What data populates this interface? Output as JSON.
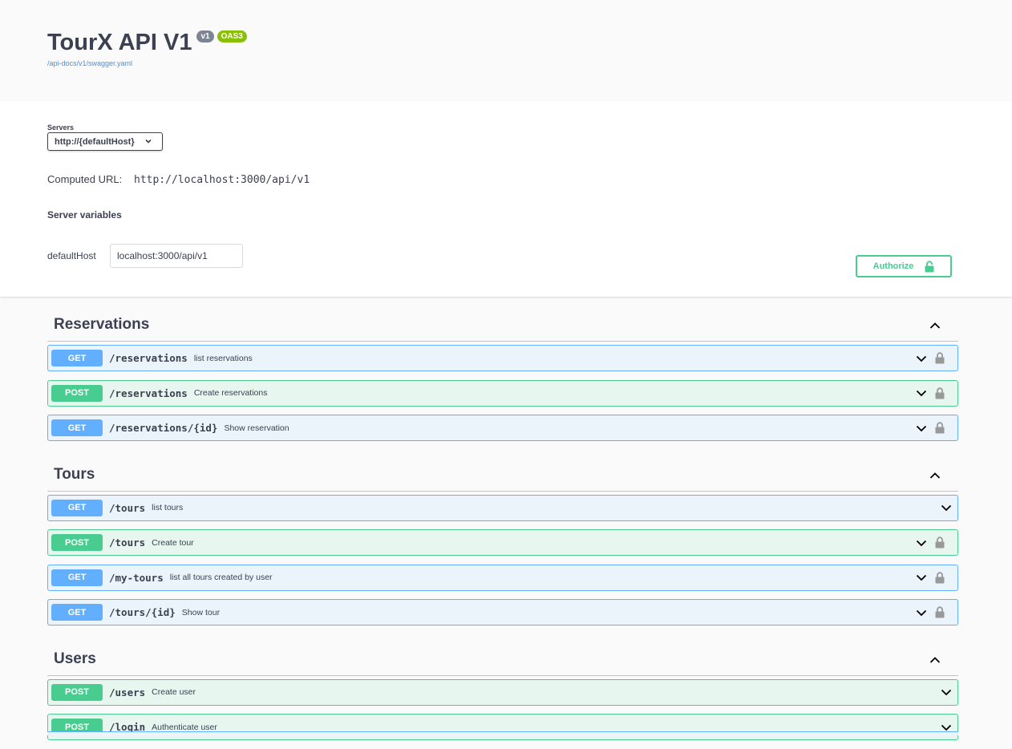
{
  "info": {
    "title": "TourX API V1",
    "version_badge": "v1",
    "oas_badge": "OAS3",
    "spec_link": "/api-docs/v1/swagger.yaml"
  },
  "servers": {
    "label": "Servers",
    "selected": "http://{defaultHost}",
    "computed_label": "Computed URL:",
    "computed_url": "http://localhost:3000/api/v1",
    "variables_title": "Server variables",
    "variable_name": "defaultHost",
    "variable_value": "localhost:3000/api/v1"
  },
  "authorize": {
    "label": "Authorize"
  },
  "colors": {
    "get": "#61affe",
    "post": "#49cc90",
    "oas": "#89bf04",
    "version": "#7d8492"
  },
  "tags": [
    {
      "name": "Reservations",
      "operations": [
        {
          "method": "GET",
          "path": "/reservations",
          "summary": "list reservations",
          "locked": true
        },
        {
          "method": "POST",
          "path": "/reservations",
          "summary": "Create reservations",
          "locked": true
        },
        {
          "method": "GET",
          "path": "/reservations/{id}",
          "summary": "Show reservation",
          "locked": true
        }
      ]
    },
    {
      "name": "Tours",
      "operations": [
        {
          "method": "GET",
          "path": "/tours",
          "summary": "list tours",
          "locked": false
        },
        {
          "method": "POST",
          "path": "/tours",
          "summary": "Create tour",
          "locked": true
        },
        {
          "method": "GET",
          "path": "/my-tours",
          "summary": "list all tours created by user",
          "locked": true
        },
        {
          "method": "GET",
          "path": "/tours/{id}",
          "summary": "Show tour",
          "locked": true
        }
      ]
    },
    {
      "name": "Users",
      "operations": [
        {
          "method": "POST",
          "path": "/users",
          "summary": "Create user",
          "locked": false
        },
        {
          "method": "POST",
          "path": "/login",
          "summary": "Authenticate user",
          "locked": false
        }
      ]
    }
  ]
}
